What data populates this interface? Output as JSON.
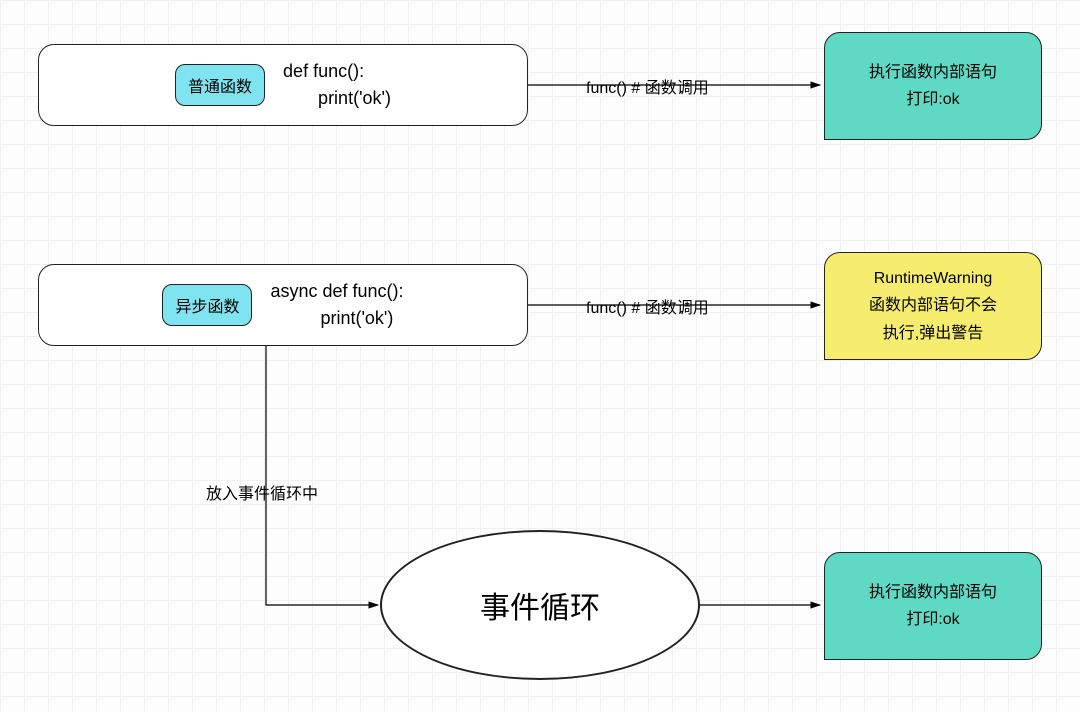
{
  "nodes": {
    "normal_func": {
      "badge": "普通函数",
      "code": "def func():\n       print('ok')"
    },
    "async_func": {
      "badge": "异步函数",
      "code": "async def func():\n          print('ok')"
    },
    "event_loop": "事件循环",
    "result_normal": "执行函数内部语句\n打印:ok",
    "result_warning": "RuntimeWarning\n函数内部语句不会\n执行,弹出警告",
    "result_loop": "执行函数内部语句\n打印:ok"
  },
  "edges": {
    "call1": "func() # 函数调用",
    "call2": "func() # 函数调用",
    "to_loop": "放入事件循环中"
  }
}
